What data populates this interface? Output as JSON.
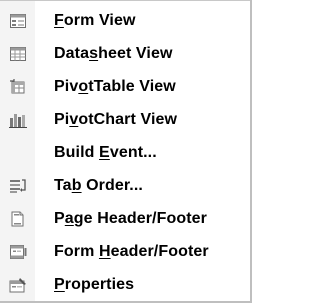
{
  "menu": {
    "items": [
      {
        "id": "form-view",
        "icon": "form-view-icon",
        "label": "Form View",
        "mnemonic_index": 0
      },
      {
        "id": "datasheet-view",
        "icon": "datasheet-view-icon",
        "label": "Datasheet View",
        "mnemonic_index": 4
      },
      {
        "id": "pivottable-view",
        "icon": "pivottable-view-icon",
        "label": "PivotTable View",
        "mnemonic_index": 3
      },
      {
        "id": "pivotchart-view",
        "icon": "pivotchart-view-icon",
        "label": "PivotChart View",
        "mnemonic_index": 2
      },
      {
        "id": "build-event",
        "icon": "",
        "label": "Build Event...",
        "mnemonic_index": 6
      },
      {
        "id": "tab-order",
        "icon": "tab-order-icon",
        "label": "Tab Order...",
        "mnemonic_index": 2
      },
      {
        "id": "page-header-footer",
        "icon": "page-header-footer-icon",
        "label": "Page Header/Footer",
        "mnemonic_index": 1
      },
      {
        "id": "form-header-footer",
        "icon": "form-header-footer-icon",
        "label": "Form Header/Footer",
        "mnemonic_index": 5
      },
      {
        "id": "properties",
        "icon": "properties-icon",
        "label": "Properties",
        "mnemonic_index": 0
      }
    ]
  }
}
